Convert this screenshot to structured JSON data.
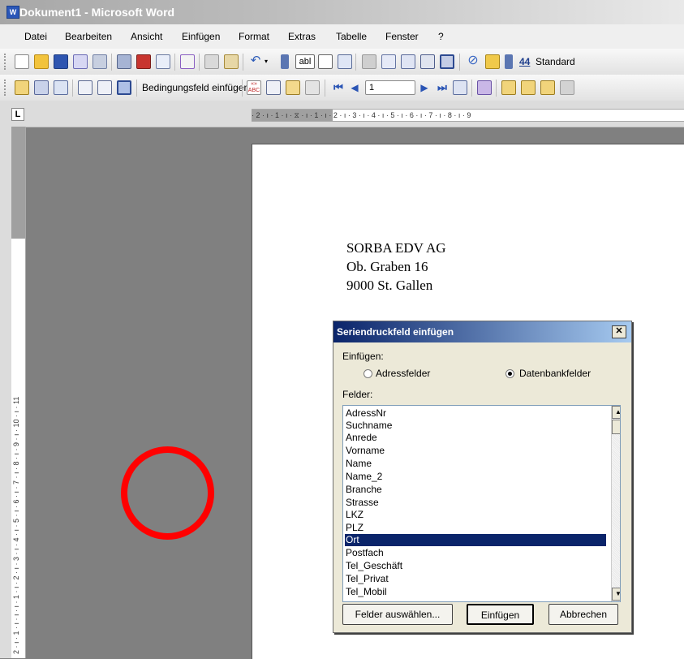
{
  "window": {
    "title": "Dokument1 - Microsoft Word",
    "app_icon": "W"
  },
  "menu": [
    {
      "label": "Datei",
      "accel": "D"
    },
    {
      "label": "Bearbeiten",
      "accel": "B"
    },
    {
      "label": "Ansicht",
      "accel": "A"
    },
    {
      "label": "Einfügen",
      "accel": "E"
    },
    {
      "label": "Format",
      "accel": "t"
    },
    {
      "label": "Extras",
      "accel": "x"
    },
    {
      "label": "Tabelle",
      "accel": "l"
    },
    {
      "label": "Fenster",
      "accel": "F"
    },
    {
      "label": "?",
      "accel": "?"
    }
  ],
  "toolbar1": {
    "style_box": "Standard",
    "style_icon": "44"
  },
  "toolbar2": {
    "insert_field_button": "Bedingungsfeld einfügen ▾",
    "record_number": "1",
    "merge_icon_text": "«»\nABC"
  },
  "ruler": {
    "h_label": "· 2 · ı · 1 · ı · ⧖ · ı · 1 · ı · 2 · ı · 3 · ı · 4 · ı · 5 · ı · 6 · ı · 7 · ı · 8 · ı · 9",
    "tab_selector": "L",
    "v_label": "2 · ı · 1 · ı · ı · ı · 1 · ı · 2 · ı · 3 · ı · 4 · ı · 5 · ı · 6 · ı · 7 · ı · 8 · ı · 9 · ı · 10 · ı · 11"
  },
  "document": {
    "address": [
      "SORBA EDV AG",
      "Ob. Graben 16",
      "9000 St. Gallen"
    ]
  },
  "dialog": {
    "title": "Seriendruckfeld einfügen",
    "close": "✕",
    "insert_label": "Einfügen:",
    "radio_address": "Adressfelder",
    "radio_database": "Datenbankfelder",
    "fields_label": "Felder:",
    "fields": [
      "AdressNr",
      "Suchname",
      "Anrede",
      "Vorname",
      "Name",
      "Name_2",
      "Branche",
      "Strasse",
      "LKZ",
      "PLZ",
      "Ort",
      "Postfach",
      "Tel_Geschäft",
      "Tel_Privat",
      "Tel_Mobil"
    ],
    "selected_field": "Ort",
    "btn_select": "Felder auswählen...",
    "btn_insert": "Einfügen",
    "btn_cancel": "Abbrechen"
  },
  "colors": {
    "selection": "#0a246a",
    "annotation_circle": "#ff0000",
    "workspace": "#808080"
  }
}
